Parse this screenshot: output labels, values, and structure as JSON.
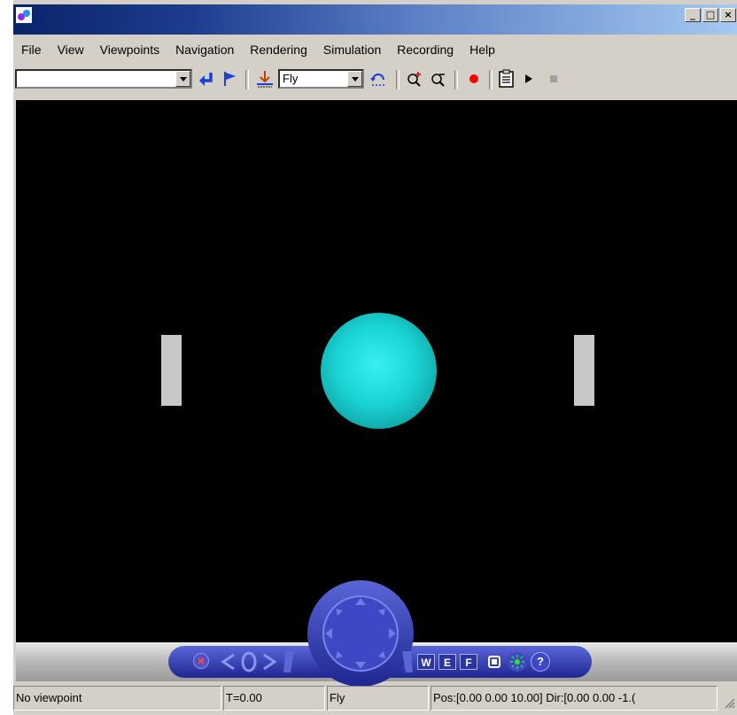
{
  "window": {
    "minimize_label": "_",
    "maximize_label": "□",
    "close_label": "×"
  },
  "menu": {
    "items": [
      "File",
      "View",
      "Viewpoints",
      "Navigation",
      "Rendering",
      "Simulation",
      "Recording",
      "Help"
    ]
  },
  "toolbar": {
    "viewpoint_combo_value": "",
    "nav_mode_value": "Fly",
    "icons": [
      "return-arrow-icon",
      "flag-icon",
      "ground-icon",
      "undo-rotate-icon",
      "zoom-in-icon",
      "zoom-out-icon",
      "record-icon",
      "clipboard-icon",
      "play-icon",
      "stop-icon"
    ]
  },
  "scene": {
    "background": "#000000",
    "sphere_color": "#1ad4d4",
    "paddle_color": "#c8c8c8"
  },
  "navpanel": {
    "w_label": "W",
    "e_label": "E",
    "f_label": "F",
    "help_label": "?",
    "accent": "#2b35a0"
  },
  "status": {
    "viewpoint": "No viewpoint",
    "time": "T=0.00",
    "mode": "Fly",
    "pos": "Pos:[0.00 0.00 10.00] Dir:[0.00 0.00 -1.("
  }
}
